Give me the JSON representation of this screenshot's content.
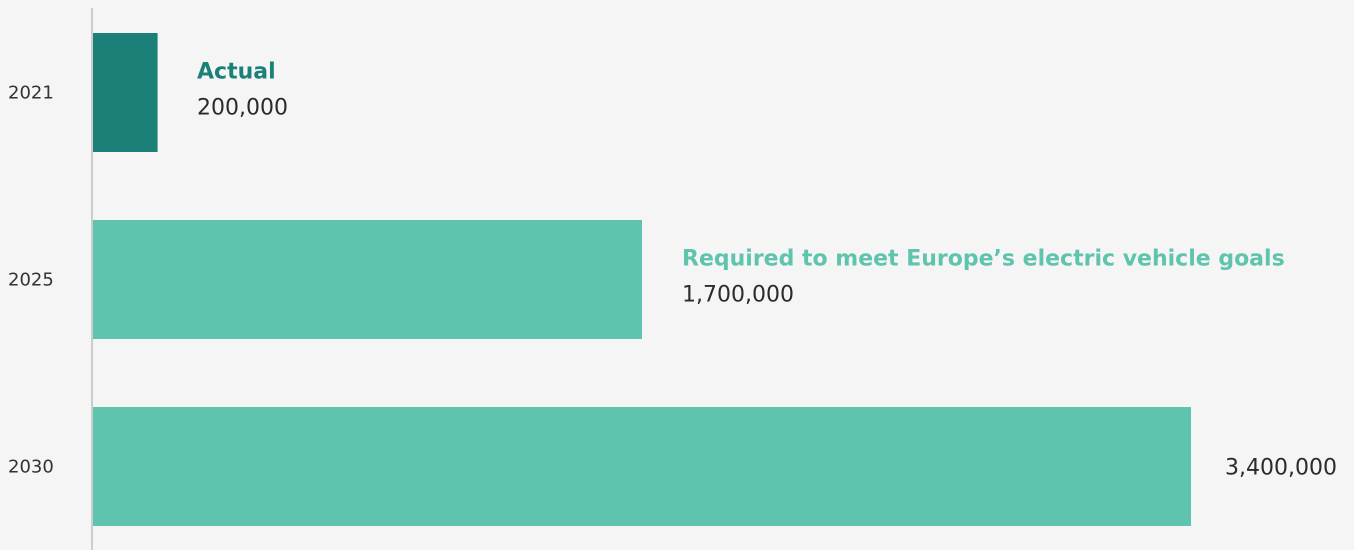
{
  "chart_data": {
    "type": "bar",
    "orientation": "horizontal",
    "categories": [
      "2021",
      "2025",
      "2030"
    ],
    "values": [
      200000,
      1700000,
      3400000
    ],
    "value_labels": [
      "200,000",
      "1,700,000",
      "3,400,000"
    ],
    "series": [
      {
        "name": "Actual",
        "color": "#1b8077",
        "category_indices": [
          0
        ]
      },
      {
        "name": "Required to meet Europe’s electric vehicle goals",
        "color": "#5ec4ad",
        "category_indices": [
          1,
          2
        ]
      }
    ],
    "series_name_shown_on": [
      0,
      1
    ],
    "xlim": [
      0,
      3400000
    ],
    "grid": false,
    "legend": "none",
    "title": "",
    "xlabel": "",
    "ylabel": ""
  },
  "colors": {
    "background": "#f5f5f5",
    "axis": "#cccccc",
    "actual": "#1b8077",
    "required": "#5ec4ad",
    "text": "#2b2b2b"
  }
}
